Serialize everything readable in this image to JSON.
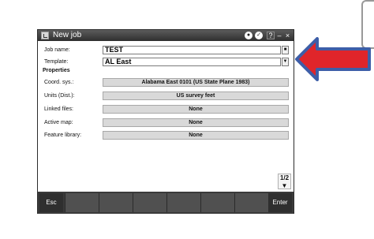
{
  "window": {
    "title": "New job",
    "icons": [
      "record-icon",
      "satellite-icon",
      "help-icon",
      "minimize-icon",
      "close-icon"
    ],
    "help_label": "?",
    "minimize_label": "–",
    "close_label": "×"
  },
  "form": {
    "job_name": {
      "label": "Job name:",
      "value": "TEST"
    },
    "template": {
      "label": "Template:",
      "value": "AL East"
    }
  },
  "properties": {
    "heading": "Properties",
    "items": [
      {
        "label": "Coord. sys.:",
        "value": "Alabama East 0101 (US State Plane 1983)"
      },
      {
        "label": "Units (Dist.):",
        "value": "US survey feet"
      },
      {
        "label": "Linked files:",
        "value": "None"
      },
      {
        "label": "Active map:",
        "value": "None"
      },
      {
        "label": "Feature library:",
        "value": "None"
      }
    ]
  },
  "paging": {
    "label": "1/2"
  },
  "bottom": {
    "esc": "Esc",
    "enter": "Enter"
  },
  "colors": {
    "arrow_fill": "#e0252a",
    "arrow_outline": "#3d5ea8",
    "titlebar": "#3a3a3a",
    "button_gray": "#d9d9d9"
  }
}
